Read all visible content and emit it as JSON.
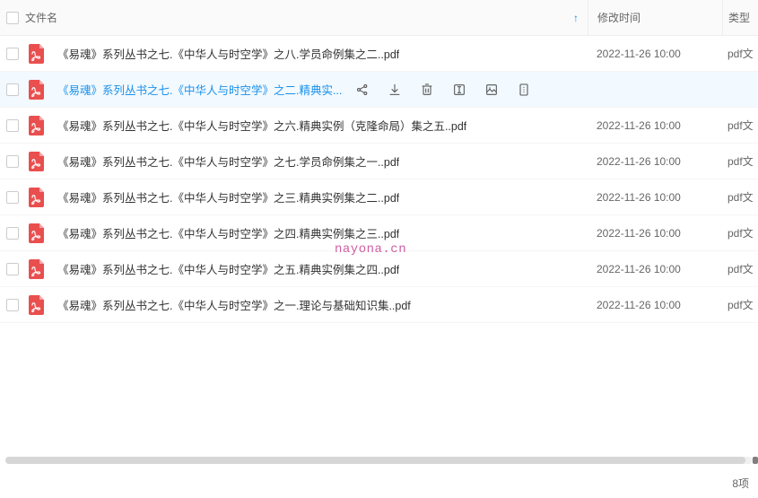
{
  "header": {
    "name": "文件名",
    "date": "修改时间",
    "type": "类型"
  },
  "rows": [
    {
      "name": "《易魂》系列丛书之七.《中华人与时空学》之八.学员命例集之二..pdf",
      "date": "2022-11-26 10:00",
      "type": "pdf文"
    },
    {
      "name": "《易魂》系列丛书之七.《中华人与时空学》之二.精典实...",
      "date": "",
      "type": ""
    },
    {
      "name": "《易魂》系列丛书之七.《中华人与时空学》之六.精典实例（克隆命局）集之五..pdf",
      "date": "2022-11-26 10:00",
      "type": "pdf文"
    },
    {
      "name": "《易魂》系列丛书之七.《中华人与时空学》之七.学员命例集之一..pdf",
      "date": "2022-11-26 10:00",
      "type": "pdf文"
    },
    {
      "name": "《易魂》系列丛书之七.《中华人与时空学》之三.精典实例集之二..pdf",
      "date": "2022-11-26 10:00",
      "type": "pdf文"
    },
    {
      "name": "《易魂》系列丛书之七.《中华人与时空学》之四.精典实例集之三..pdf",
      "date": "2022-11-26 10:00",
      "type": "pdf文"
    },
    {
      "name": "《易魂》系列丛书之七.《中华人与时空学》之五.精典实例集之四..pdf",
      "date": "2022-11-26 10:00",
      "type": "pdf文"
    },
    {
      "name": "《易魂》系列丛书之七.《中华人与时空学》之一.理论与基础知识集..pdf",
      "date": "2022-11-26 10:00",
      "type": "pdf文"
    }
  ],
  "watermark": "nayona.cn",
  "footer": "8项",
  "hover_index": 1
}
